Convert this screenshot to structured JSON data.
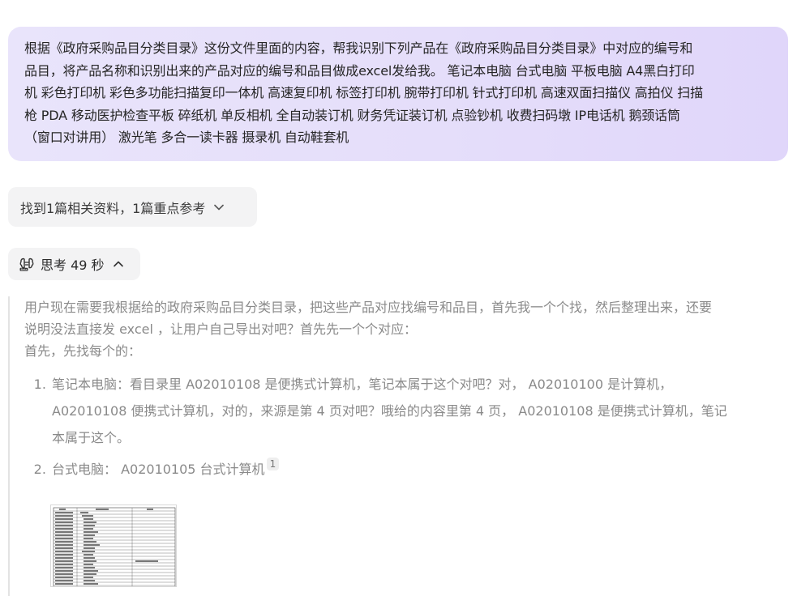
{
  "user_message": {
    "lines": [
      "根据《政府采购品目分类目录》这份文件里面的内容，帮我识别下列产品在《政府采购品目分类目录》中对应的编号和",
      "品目，将产品名称和识别出来的产品对应的编号和品目做成excel发给我。 笔记本电脑 台式电脑 平板电脑 A4黑白打印",
      "机 彩色打印机 彩色多功能扫描复印一体机 高速复印机 标签打印机 腕带打印机 针式打印机 高速双面扫描仪 高拍仪 扫描",
      "枪 PDA 移动医护检查平板 碎纸机 单反相机 全自动装订机 财务凭证装订机 点验钞机 收费扫码墩 IP电话机 鹅颈话筒",
      "（窗口对讲用） 激光笔 多合一读卡器 摄录机 自动鞋套机"
    ]
  },
  "references": {
    "label": "找到1篇相关资料，1篇重点参考",
    "icon": "chevron-down-icon"
  },
  "thinking": {
    "label": "思考 49 秒",
    "badge_icon": "beta-brain-icon",
    "toggle_icon": "chevron-up-icon",
    "intro_lines": [
      "用户现在需要我根据给的政府采购品目分类目录，把这些产品对应找编号和品目，首先我一个个找，然后整理出来，还要",
      "说明没法直接发 excel ，让用户自己导出对吧？首先先一个个对应：",
      "首先，先找每个的："
    ],
    "items": [
      {
        "lines": [
          "笔记本电脑：看目录里 A02010108 是便携式计算机，笔记本属于这个对吧？对， A02010100 是计算机，",
          "A02010108 便携式计算机，对的，来源是第 4 页对吧？哦给的内容里第 4 页， A02010108 是便携式计算机，笔记",
          "本属于这个。"
        ]
      },
      {
        "lines": [
          "台式电脑： A02010105 台式计算机"
        ],
        "citation": "1"
      }
    ]
  },
  "colors": {
    "bubble_start": "#e9e4fb",
    "bubble_end": "#e0d6fa",
    "pill_bg": "#f3f3f4",
    "thinking_text": "#8a8a8a"
  }
}
